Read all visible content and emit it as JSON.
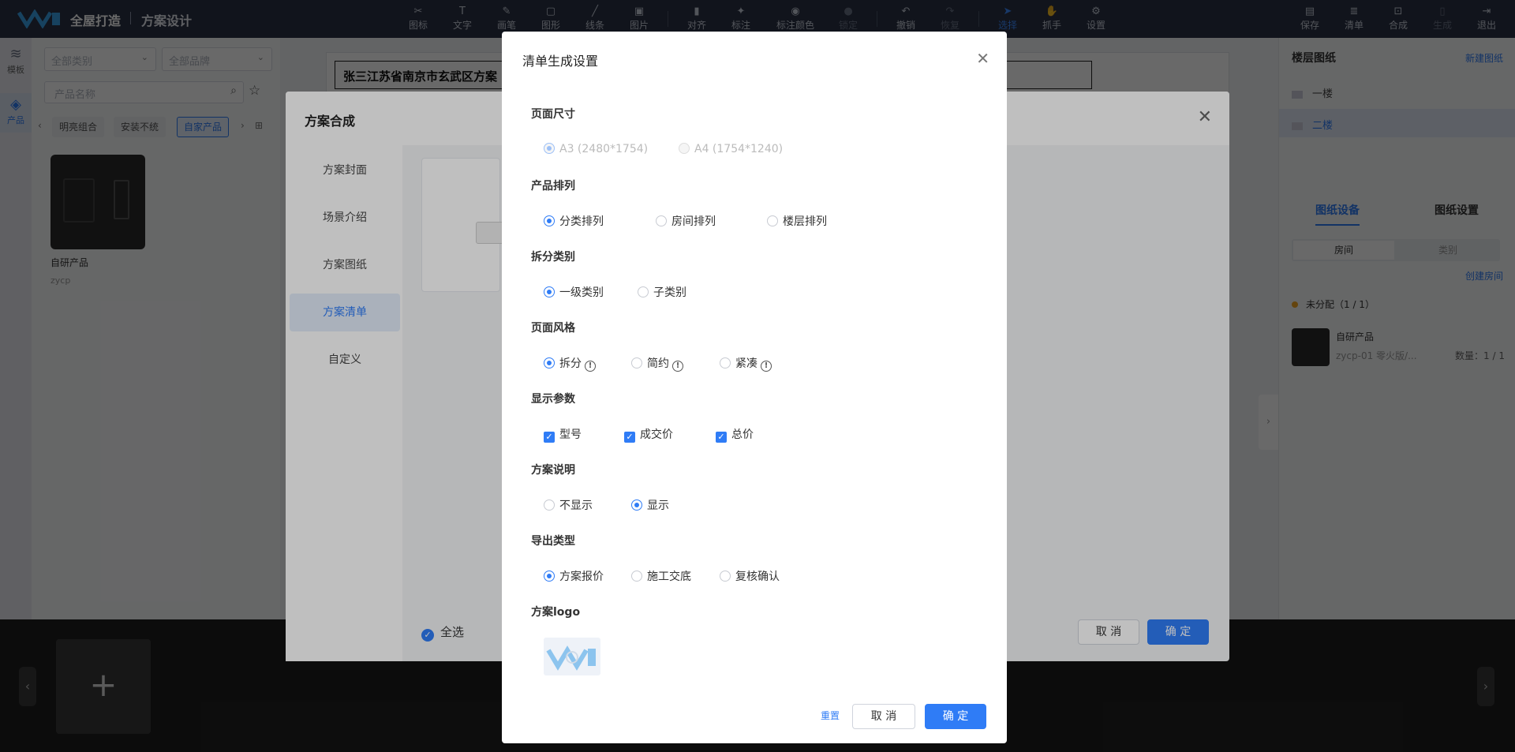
{
  "app": {
    "brand": "全屋打造",
    "subtitle": "方案设计"
  },
  "toolbar": {
    "tools": [
      {
        "label": "图标",
        "icon": "scissors-icon"
      },
      {
        "label": "文字",
        "icon": "text-icon"
      },
      {
        "label": "画笔",
        "icon": "pen-icon"
      },
      {
        "label": "图形",
        "icon": "shape-icon"
      },
      {
        "label": "线条",
        "icon": "line-icon"
      },
      {
        "label": "图片",
        "icon": "image-icon"
      },
      {
        "label": "对齐",
        "icon": "align-icon"
      },
      {
        "label": "标注",
        "icon": "pin-icon"
      },
      {
        "label": "标注颜色",
        "icon": "palette-icon"
      },
      {
        "label": "锁定",
        "icon": "lock-icon"
      },
      {
        "label": "撤销",
        "icon": "undo-icon"
      },
      {
        "label": "恢复",
        "icon": "redo-icon"
      },
      {
        "label": "选择",
        "icon": "cursor-icon"
      },
      {
        "label": "抓手",
        "icon": "hand-icon"
      },
      {
        "label": "设置",
        "icon": "gear-icon"
      }
    ],
    "actions": [
      {
        "label": "保存",
        "icon": "save-icon"
      },
      {
        "label": "清单",
        "icon": "list-icon"
      },
      {
        "label": "合成",
        "icon": "compose-icon"
      },
      {
        "label": "生成",
        "icon": "generate-icon"
      },
      {
        "label": "退出",
        "icon": "exit-icon"
      }
    ]
  },
  "rail": {
    "template": "模板",
    "product": "产品"
  },
  "leftpanel": {
    "category_placeholder": "全部类别",
    "brand_placeholder": "全部品牌",
    "search_placeholder": "产品名称",
    "chips": [
      "明亮组合",
      "安装不统",
      "自家产品"
    ],
    "product": {
      "name": "自研产品",
      "code": "zycp"
    }
  },
  "sheet": {
    "title": "张三江苏省南京市玄武区方案"
  },
  "rightpanel": {
    "title": "楼层图纸",
    "new_drawing": "新建图纸",
    "floors": [
      "一楼",
      "二楼"
    ],
    "tabs": [
      "图纸设备",
      "图纸设置"
    ],
    "segments": [
      "房间",
      "类别"
    ],
    "create_room": "创建房间",
    "unassigned": "未分配（1 / 1）",
    "item": {
      "name": "自研产品",
      "code": "zycp-01 零火版/...",
      "qty": "数量：1 / 1"
    }
  },
  "compose": {
    "title": "方案合成",
    "nav": [
      "方案封面",
      "场景介绍",
      "方案图纸",
      "方案清单",
      "自定义"
    ],
    "select_all": "全选",
    "cancel": "取 消",
    "confirm": "确 定"
  },
  "dialog": {
    "title": "清单生成设置",
    "sections": {
      "page_size": {
        "title": "页面尺寸",
        "options": [
          "A3 (2480*1754)",
          "A4 (1754*1240)"
        ]
      },
      "product_order": {
        "title": "产品排列",
        "options": [
          "分类排列",
          "房间排列",
          "楼层排列"
        ]
      },
      "split_category": {
        "title": "拆分类别",
        "options": [
          "一级类别",
          "子类别"
        ]
      },
      "page_style": {
        "title": "页面风格",
        "options": [
          "拆分",
          "简约",
          "紧凑"
        ]
      },
      "display_params": {
        "title": "显示参数",
        "options": [
          "型号",
          "成交价",
          "总价"
        ]
      },
      "description": {
        "title": "方案说明",
        "options": [
          "不显示",
          "显示"
        ]
      },
      "export_type": {
        "title": "导出类型",
        "options": [
          "方案报价",
          "施工交底",
          "复核确认"
        ]
      },
      "logo": {
        "title": "方案logo"
      }
    },
    "reset": "重置",
    "cancel": "取 消",
    "confirm": "确 定"
  }
}
